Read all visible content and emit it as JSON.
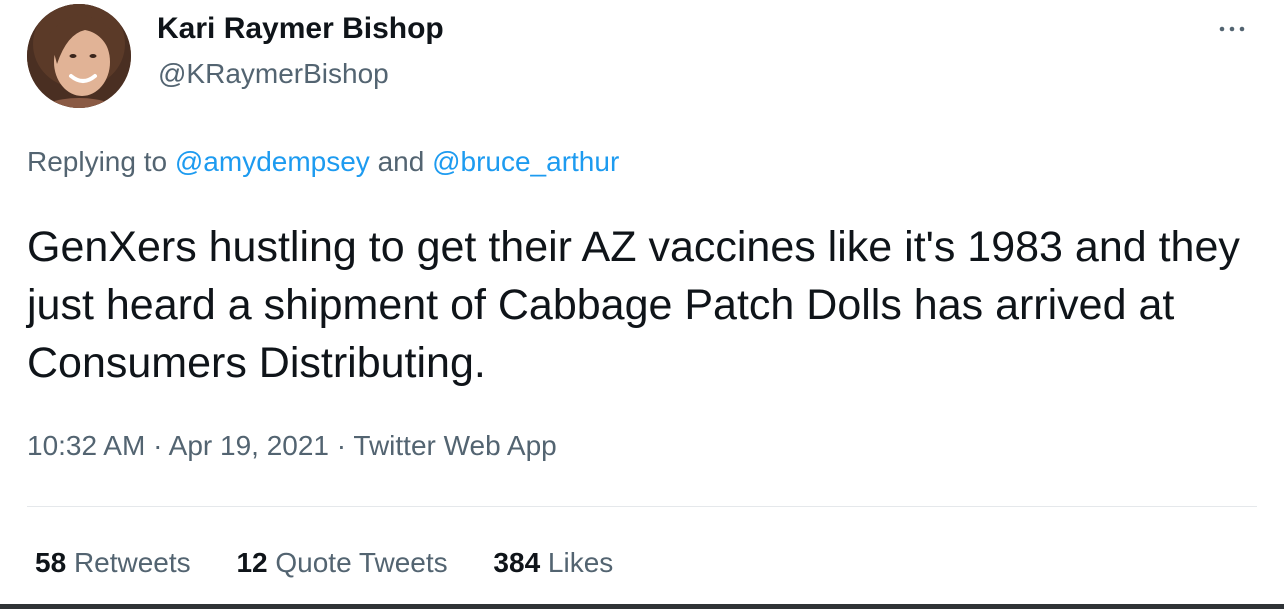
{
  "author": {
    "display_name": "Kari Raymer Bishop",
    "handle": "@KRaymerBishop",
    "avatar_icon": "user-avatar-photo"
  },
  "more_icon": "more-horizontal-icon",
  "reply": {
    "prefix": "Replying to",
    "mention_1": "@amydempsey",
    "conjunction": "and",
    "mention_2": "@bruce_arthur"
  },
  "tweet": {
    "text": "GenXers hustling to get their AZ vaccines like it's 1983 and they just heard a shipment of Cabbage Patch Dolls has arrived at Consumers Distributing."
  },
  "meta": {
    "time": "10:32 AM",
    "separator": "·",
    "date": "Apr 19, 2021",
    "source": "Twitter Web App"
  },
  "stats": {
    "retweets_count": "58",
    "retweets_label": "Retweets",
    "quotes_count": "12",
    "quotes_label": "Quote Tweets",
    "likes_count": "384",
    "likes_label": "Likes"
  },
  "colors": {
    "link": "#1d9bf0",
    "secondary_text": "#536471",
    "primary_text": "#0f1419"
  }
}
